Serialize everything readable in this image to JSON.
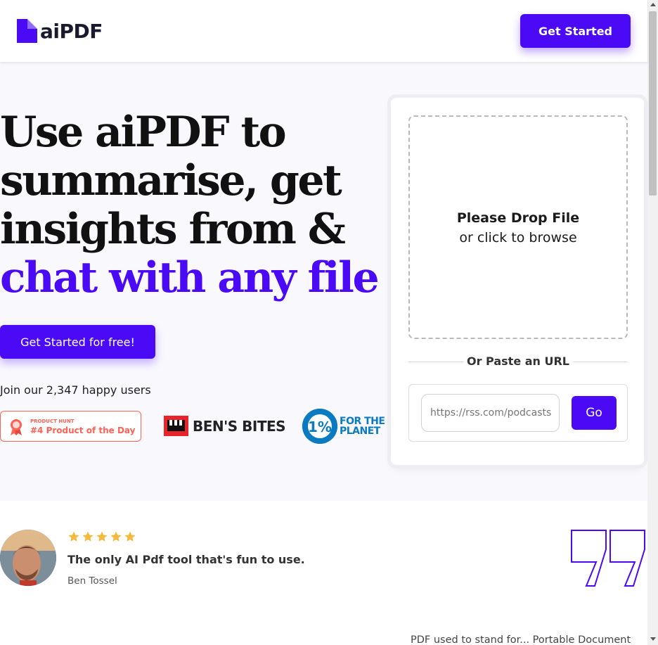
{
  "header": {
    "logo_text": "aiPDF",
    "get_started_label": "Get Started"
  },
  "hero": {
    "headline_line1": "Use aiPDF to",
    "headline_line2": "summarise, get",
    "headline_line3": "insights from &",
    "headline_accent": "chat with any file",
    "cta_label": "Get Started for free!",
    "join_text": "Join our 2,347 happy users"
  },
  "badges": {
    "product_hunt_small": "PRODUCT HUNT",
    "product_hunt_big": "#4 Product of the Day",
    "bens_bites": "BEN'S BITES",
    "planet_line1": "FOR THE",
    "planet_line2": "PLANET",
    "planet_symbol": "1%"
  },
  "upload": {
    "drop_title": "Please Drop File",
    "drop_sub": "or click to browse",
    "or_text": "Or Paste an URL",
    "url_placeholder": "https://rss.com/podcasts",
    "go_label": "Go"
  },
  "testimonial": {
    "rating": 5,
    "quote": "The only AI Pdf tool that's fun to use.",
    "author": "Ben Tossel"
  },
  "next_section": {
    "text": "PDF used to stand for... Portable Document"
  },
  "colors": {
    "accent": "#4b0af5",
    "star": "#f6b93b",
    "product_hunt": "#ff6154",
    "planet": "#0a7bc0"
  }
}
